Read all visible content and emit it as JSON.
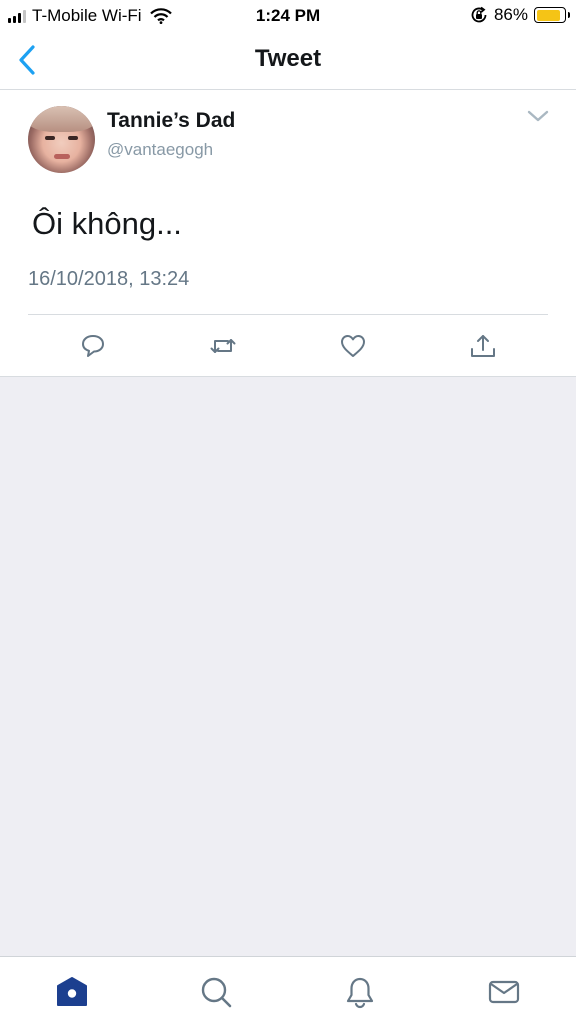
{
  "status_bar": {
    "carrier": "T-Mobile Wi-Fi",
    "time": "1:24 PM",
    "battery": "86%",
    "battery_level": 0.86,
    "battery_color": "#f5c416",
    "icons": [
      "signal-icon",
      "wifi-icon",
      "rotation-lock-icon",
      "battery-icon"
    ]
  },
  "header": {
    "title": "Tweet",
    "back_icon": "chevron-left-icon",
    "accent_color": "#1da1f2"
  },
  "tweet": {
    "author_name": "Tannie’s Dad",
    "author_handle": "@vantaegogh",
    "text": "Ôi không...",
    "timestamp": "16/10/2018, 13:24",
    "menu_icon": "chevron-down-icon",
    "actions": [
      "reply-icon",
      "retweet-icon",
      "like-icon",
      "share-icon"
    ]
  },
  "tabbar": {
    "items": [
      "home-icon",
      "search-icon",
      "notifications-icon",
      "messages-icon"
    ],
    "active": "home-icon",
    "active_color": "#1c3f8f"
  }
}
